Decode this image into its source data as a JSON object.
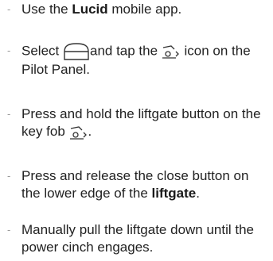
{
  "steps": [
    {
      "parts": {
        "a": "Use the ",
        "b": "Lucid",
        "c": " mobile app."
      }
    },
    {
      "parts": {
        "a": "Select ",
        "b": "and tap the ",
        "c": " icon on the Pilot Panel."
      },
      "icons": [
        "car-front-icon",
        "liftgate-icon"
      ]
    },
    {
      "parts": {
        "a": "Press and hold the liftgate button on the key fob ",
        "b": "."
      },
      "icons": [
        "liftgate-icon"
      ]
    },
    {
      "parts": {
        "a": "Press and release the close button on the lower edge of the ",
        "b": "liftgate",
        "c": "."
      }
    },
    {
      "parts": {
        "a": "Manually pull the liftgate down until the power cinch engages."
      }
    }
  ],
  "bullet": "-"
}
